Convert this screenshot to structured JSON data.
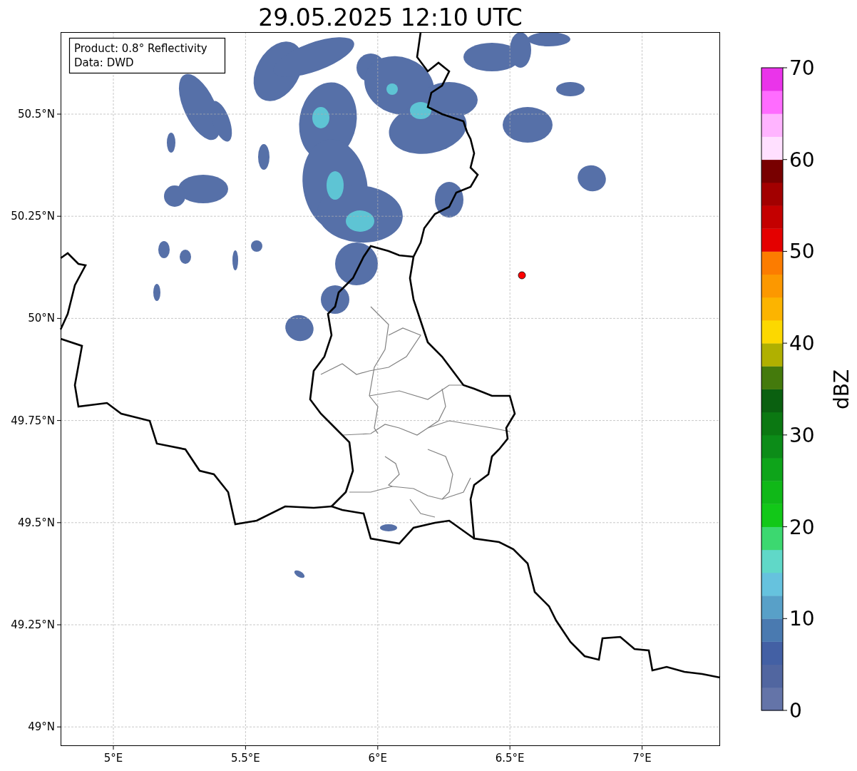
{
  "title": "29.05.2025 12:10 UTC",
  "info_box": [
    "Product: 0.8° Reflectivity",
    "Data: DWD"
  ],
  "y_ticks": [
    "50.5°N",
    "50.25°N",
    "50°N",
    "49.75°N",
    "49.5°N",
    "49.25°N",
    "49°N"
  ],
  "x_ticks": [
    "5°E",
    "5.5°E",
    "6°E",
    "6.5°E",
    "7°E"
  ],
  "colorbar": {
    "label": "dBZ",
    "ticks": [
      "70",
      "60",
      "50",
      "40",
      "30",
      "20",
      "10",
      "0"
    ],
    "bins": [
      {
        "color": "#6474a8"
      },
      {
        "color": "#5166a0"
      },
      {
        "color": "#4360a4"
      },
      {
        "color": "#4a7ab0"
      },
      {
        "color": "#58a0c8"
      },
      {
        "color": "#66c2de"
      },
      {
        "color": "#60d8c8"
      },
      {
        "color": "#3cd870"
      },
      {
        "color": "#12c818"
      },
      {
        "color": "#10b818"
      },
      {
        "color": "#0ea41a"
      },
      {
        "color": "#0c8c18"
      },
      {
        "color": "#0b7812"
      },
      {
        "color": "#0a6010"
      },
      {
        "color": "#447a0c"
      },
      {
        "color": "#b0b000"
      },
      {
        "color": "#fcd800"
      },
      {
        "color": "#fcb400"
      },
      {
        "color": "#fc9800"
      },
      {
        "color": "#fc7c00"
      },
      {
        "color": "#e40000"
      },
      {
        "color": "#c40000"
      },
      {
        "color": "#a20000"
      },
      {
        "color": "#780000"
      },
      {
        "color": "#ffe0ff"
      },
      {
        "color": "#ffb4ff"
      },
      {
        "color": "#ff6cff"
      },
      {
        "color": "#ea34ea"
      }
    ]
  }
}
